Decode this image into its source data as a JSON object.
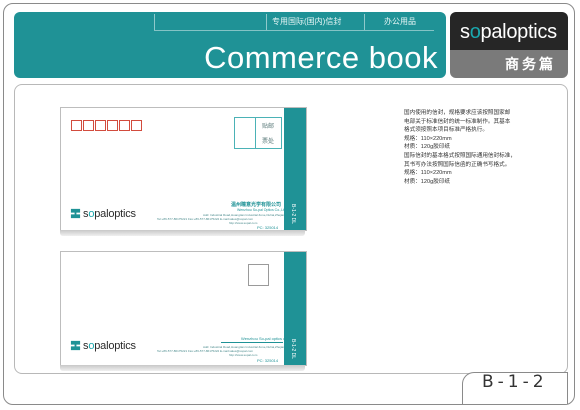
{
  "header": {
    "nav_items": [
      "专用国际(国内)信封",
      "办公用品"
    ],
    "title": "Commerce book"
  },
  "brand": {
    "logo_pre": "s",
    "logo_o": "o",
    "logo_post": "paloptics",
    "subtitle": "商务篇",
    "colors": {
      "teal": "#1f9296",
      "dark": "#262626",
      "gray": "#7a7a7a"
    }
  },
  "envelope_domestic": {
    "stamp_label_top": "贴邮",
    "stamp_label_bottom": "票处",
    "company_cn": "温州瞳意光学有限公司",
    "company_en": "Wenzhou So-pal Optics Co.,Ltd",
    "address_1": "Add: Industrial Road,Huangtian Industrial Zone,Ouhai,Zhejiang,China",
    "address_2": "Tel:+86-577-86175221 Fax:+86-577-86175222 E-mail:sales@sopal.com",
    "address_3": "http://www.sopal.com",
    "postcode": "PC: 325014",
    "logo_pre": "s",
    "logo_o": "o",
    "logo_post": "paloptics",
    "strip_text": "B-1-2 DL"
  },
  "envelope_international": {
    "company_en": "Wenzhou So-pal optics co.,ltd",
    "address_1": "Add: Industrial Road,Huangtian Industrial Zone,Ouhai,Zhejiang,China",
    "address_2": "Tel:+86-577-86175221 Fax:+86-577-86175222 E-mail:sales@sopal.com",
    "address_3": "http://www.sopal.com",
    "postcode": "PC: 325014",
    "logo_pre": "s",
    "logo_o": "o",
    "logo_post": "paloptics",
    "strip_text": "B-1-2 DL"
  },
  "description": [
    "国内使用的信封，规格要求应该按照国家邮",
    "电部关于标准信封的统一标准制作。其基本",
    "格式须按照本项目标准严格执行。",
    "规格：110×220mm",
    "材质：120g胶印纸",
    "国际信封的基本格式按照国际通用信封标准，",
    "其书写办法按照国际信函的正确书写格式。",
    "规格：110×220mm",
    "材质：120g胶印纸"
  ],
  "page_number": "B-1-2"
}
